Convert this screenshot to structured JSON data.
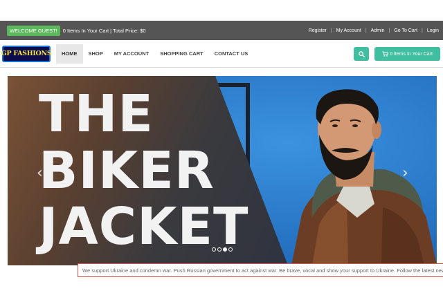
{
  "topbar": {
    "welcome": "WELCOME GUEST!",
    "cart_summary": "0 Items In Your Cart | Total Price: $0",
    "links": [
      "Register",
      "My Account",
      "Admin",
      "Go To Cart",
      "Login"
    ]
  },
  "nav": {
    "logo_text": "GP FASHIONS",
    "items": [
      "HOME",
      "SHOP",
      "MY ACCOUNT",
      "SHOPPING CART",
      "CONTACT US"
    ],
    "active_item": "HOME",
    "cart_button": "0 Items In Your Cart"
  },
  "hero": {
    "line1": "THE",
    "line2": "BIKER",
    "line3": "JACKET",
    "slide_count": 3,
    "active_slide": 3
  },
  "ticker": {
    "text": "We support Ukraine and condemn war. Push Russian government to act against war. Be brave, vocal and show your support to Ukraine. Follow the latest news HERE"
  },
  "colors": {
    "topbar_bg": "#555555",
    "accent_green": "#5cb85c",
    "accent_teal": "#3fbf9f",
    "ticker_border": "#d9534f"
  }
}
